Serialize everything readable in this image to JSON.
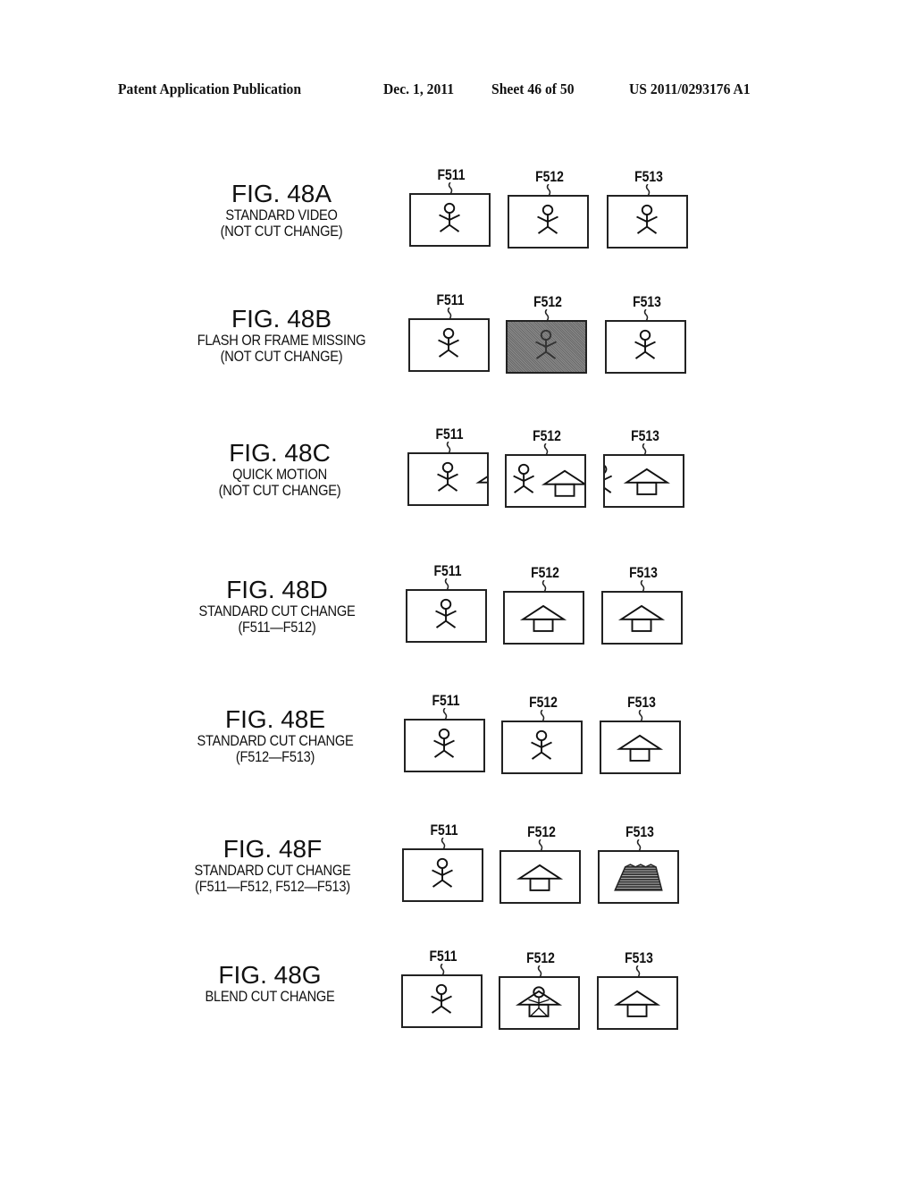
{
  "header": {
    "publication": "Patent Application Publication",
    "date": "Dec. 1, 2011",
    "sheet": "Sheet 46 of 50",
    "number": "US 2011/0293176 A1"
  },
  "figures": [
    {
      "title": "FIG. 48A",
      "desc": [
        "STANDARD VIDEO",
        "(NOT CUT CHANGE)"
      ],
      "frames": [
        {
          "id": "F511",
          "content": "person"
        },
        {
          "id": "F512",
          "content": "person"
        },
        {
          "id": "F513",
          "content": "person"
        }
      ]
    },
    {
      "title": "FIG. 48B",
      "desc": [
        "FLASH OR FRAME MISSING",
        "(NOT CUT CHANGE)"
      ],
      "frames": [
        {
          "id": "F511",
          "content": "person"
        },
        {
          "id": "F512",
          "content": "person-dark"
        },
        {
          "id": "F513",
          "content": "person"
        }
      ]
    },
    {
      "title": "FIG. 48C",
      "desc": [
        "QUICK MOTION",
        "(NOT CUT CHANGE)"
      ],
      "frames": [
        {
          "id": "F511",
          "content": "person-house-edge"
        },
        {
          "id": "F512",
          "content": "person-house"
        },
        {
          "id": "F513",
          "content": "person-edge-house"
        }
      ]
    },
    {
      "title": "FIG. 48D",
      "desc": [
        "STANDARD CUT CHANGE",
        "(F511—F512)"
      ],
      "frames": [
        {
          "id": "F511",
          "content": "person"
        },
        {
          "id": "F512",
          "content": "house"
        },
        {
          "id": "F513",
          "content": "house"
        }
      ]
    },
    {
      "title": "FIG. 48E",
      "desc": [
        "STANDARD CUT CHANGE",
        "(F512—F513)"
      ],
      "frames": [
        {
          "id": "F511",
          "content": "person"
        },
        {
          "id": "F512",
          "content": "person"
        },
        {
          "id": "F513",
          "content": "house"
        }
      ]
    },
    {
      "title": "FIG. 48F",
      "desc": [
        "STANDARD CUT CHANGE",
        "(F511—F512, F512—F513)"
      ],
      "frames": [
        {
          "id": "F511",
          "content": "person"
        },
        {
          "id": "F512",
          "content": "house"
        },
        {
          "id": "F513",
          "content": "hatched-shape"
        }
      ]
    },
    {
      "title": "FIG. 48G",
      "desc": [
        "BLEND CUT CHANGE",
        ""
      ],
      "frames": [
        {
          "id": "F511",
          "content": "person"
        },
        {
          "id": "F512",
          "content": "blend"
        },
        {
          "id": "F513",
          "content": "house"
        }
      ]
    }
  ]
}
